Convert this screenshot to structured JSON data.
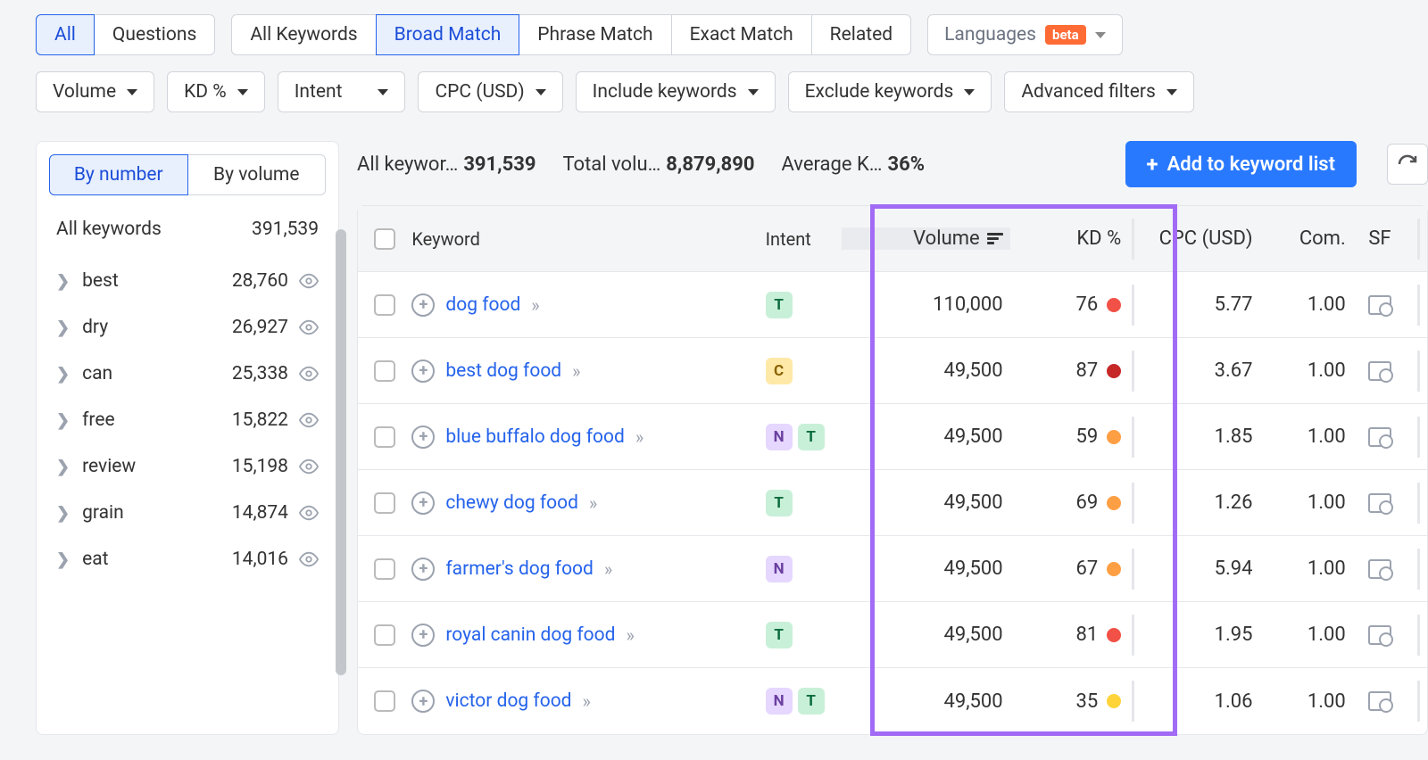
{
  "tabs1": {
    "all": "All",
    "questions": "Questions"
  },
  "tabs2": {
    "allkw": "All Keywords",
    "broad": "Broad Match",
    "phrase": "Phrase Match",
    "exact": "Exact Match",
    "related": "Related"
  },
  "lang": {
    "label": "Languages",
    "beta": "beta"
  },
  "filters": {
    "volume": "Volume",
    "kd": "KD %",
    "intent": "Intent",
    "cpc": "CPC (USD)",
    "incl": "Include keywords",
    "excl": "Exclude keywords",
    "adv": "Advanced filters"
  },
  "sidebar": {
    "by_number": "By number",
    "by_volume": "By volume",
    "all_label": "All keywords",
    "all_count": "391,539",
    "groups": [
      {
        "name": "best",
        "count": "28,760"
      },
      {
        "name": "dry",
        "count": "26,927"
      },
      {
        "name": "can",
        "count": "25,338"
      },
      {
        "name": "free",
        "count": "15,822"
      },
      {
        "name": "review",
        "count": "15,198"
      },
      {
        "name": "grain",
        "count": "14,874"
      },
      {
        "name": "eat",
        "count": "14,016"
      }
    ]
  },
  "stats": {
    "s1_label": "All keywor…",
    "s1_val": "391,539",
    "s2_label": "Total volu…",
    "s2_val": "8,879,890",
    "s3_label": "Average K…",
    "s3_val": "36%"
  },
  "addbtn": "Add to keyword list",
  "headers": {
    "kw": "Keyword",
    "intent": "Intent",
    "vol": "Volume",
    "kd": "KD %",
    "cpc": "CPC (USD)",
    "com": "Com.",
    "sf": "SF"
  },
  "rows": [
    {
      "kw": "dog food",
      "intent": [
        "T"
      ],
      "vol": "110,000",
      "kd": "76",
      "kdcolor": "#f15146",
      "cpc": "5.77",
      "com": "1.00"
    },
    {
      "kw": "best dog food",
      "intent": [
        "C"
      ],
      "vol": "49,500",
      "kd": "87",
      "kdcolor": "#c62828",
      "cpc": "3.67",
      "com": "1.00"
    },
    {
      "kw": "blue buffalo dog food",
      "intent": [
        "N",
        "T"
      ],
      "vol": "49,500",
      "kd": "59",
      "kdcolor": "#ff9f43",
      "cpc": "1.85",
      "com": "1.00"
    },
    {
      "kw": "chewy dog food",
      "intent": [
        "T"
      ],
      "vol": "49,500",
      "kd": "69",
      "kdcolor": "#ff9f43",
      "cpc": "1.26",
      "com": "1.00"
    },
    {
      "kw": "farmer's dog food",
      "intent": [
        "N"
      ],
      "vol": "49,500",
      "kd": "67",
      "kdcolor": "#ff9f43",
      "cpc": "5.94",
      "com": "1.00"
    },
    {
      "kw": "royal canin dog food",
      "intent": [
        "T"
      ],
      "vol": "49,500",
      "kd": "81",
      "kdcolor": "#f15146",
      "cpc": "1.95",
      "com": "1.00"
    },
    {
      "kw": "victor dog food",
      "intent": [
        "N",
        "T"
      ],
      "vol": "49,500",
      "kd": "35",
      "kdcolor": "#ffd43b",
      "cpc": "1.06",
      "com": "1.00"
    }
  ]
}
